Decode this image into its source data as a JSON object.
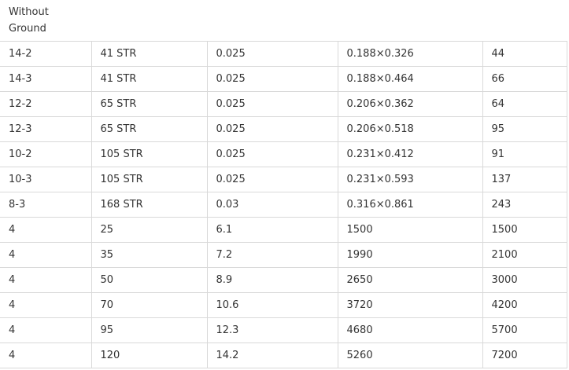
{
  "header": {
    "cell": "Without\nGround"
  },
  "rows": [
    [
      "14-2",
      "41 STR",
      "0.025",
      "0.188×0.326",
      "44"
    ],
    [
      "14-3",
      "41 STR",
      "0.025",
      "0.188×0.464",
      "66"
    ],
    [
      "12-2",
      "65 STR",
      "0.025",
      "0.206×0.362",
      "64"
    ],
    [
      "12-3",
      "65 STR",
      "0.025",
      "0.206×0.518",
      "95"
    ],
    [
      "10-2",
      "105 STR",
      "0.025",
      "0.231×0.412",
      "91"
    ],
    [
      "10-3",
      "105 STR",
      "0.025",
      "0.231×0.593",
      "137"
    ],
    [
      "8-3",
      "168 STR",
      "0.03",
      "0.316×0.861",
      "243"
    ],
    [
      "4",
      "25",
      "6.1",
      "1500",
      "1500"
    ],
    [
      "4",
      "35",
      "7.2",
      "1990",
      "2100"
    ],
    [
      "4",
      "50",
      "8.9",
      "2650",
      "3000"
    ],
    [
      "4",
      "70",
      "10.6",
      "3720",
      "4200"
    ],
    [
      "4",
      "95",
      "12.3",
      "4680",
      "5700"
    ],
    [
      "4",
      "120",
      "14.2",
      "5260",
      "7200"
    ]
  ]
}
